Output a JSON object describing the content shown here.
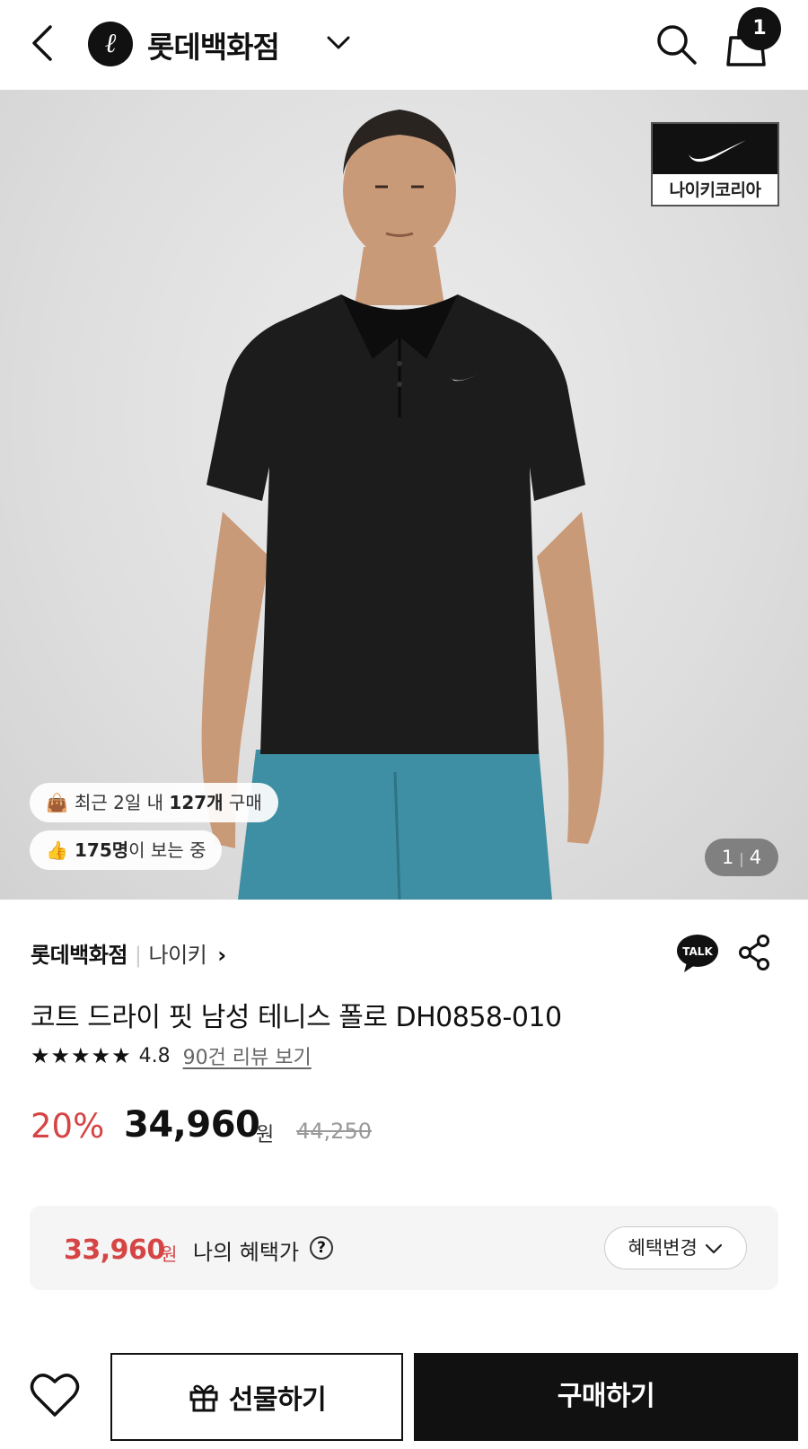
{
  "header": {
    "logo_letter": "ℓ",
    "store_name": "롯데백화점",
    "cart_count": "1"
  },
  "hero": {
    "brand_badge_label": "나이키코리아",
    "purchase_pill": {
      "emoji": "👜",
      "prefix": "최근 2일 내 ",
      "count": "127개",
      "suffix": " 구매"
    },
    "viewers_pill": {
      "emoji": "👍",
      "count": "175명",
      "suffix": "이 보는 중"
    },
    "image_index": "1",
    "image_total": "4"
  },
  "product": {
    "store": "롯데백화점",
    "brand": "나이키",
    "title": "코트 드라이 핏 남성 테니스 폴로 DH0858-010",
    "stars": "★★★★★",
    "rating": "4.8",
    "reviews_link": "90건 리뷰 보기",
    "discount": "20%",
    "price": "34,960",
    "currency": "원",
    "original_price": "44,250"
  },
  "benefit": {
    "price": "33,960",
    "currency": "원",
    "label": "나의 혜택가",
    "help": "?",
    "change_button": "혜택변경"
  },
  "actions": {
    "gift_button": "선물하기",
    "buy_button": "구매하기"
  },
  "talk_icon_label": "TALK",
  "colors": {
    "accent_red": "#d64545",
    "dark": "#111111"
  }
}
